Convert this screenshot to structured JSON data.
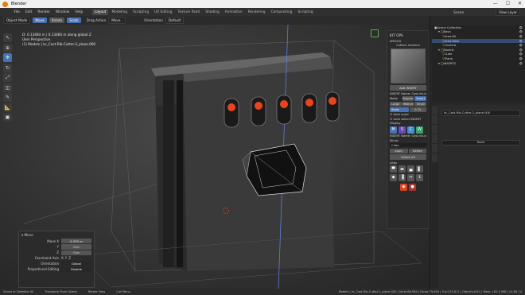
{
  "window": {
    "title": "Blender",
    "controls": [
      "—",
      "☐",
      "✕"
    ]
  },
  "menu": [
    "File",
    "Edit",
    "Render",
    "Window",
    "Help"
  ],
  "workspaces": {
    "tabs": [
      "Layout",
      "Modeling",
      "Sculpting",
      "UV Editing",
      "Texture Paint",
      "Shading",
      "Animation",
      "Rendering",
      "Compositing",
      "Scripting"
    ],
    "active": "Layout",
    "scene": "Scene",
    "view_layer": "View Layer"
  },
  "toolbar": {
    "mode": "Object Mode",
    "move": "Move",
    "rotate": "Rotate",
    "scale": "Scale",
    "drag_label": "Drag Action",
    "drag_value": "Move",
    "orientation": "Orientation",
    "orientation_value": "Default"
  },
  "viewport": {
    "info_line1": "D: 0.13484 m | 0.13484 m along global Z",
    "info_line2": "User Perspective",
    "info_line3": "(1) Models | kc_Cast-Rib-Cutter-2_plane.000"
  },
  "npanel": {
    "header": "KIT OPS",
    "kitops": "KPACKS",
    "thumb_label": "Cutters medium",
    "add_insert": "Add INSERT",
    "insert_name": "INSERT Name: Cast.rib-cu...",
    "mode_label": "Mode",
    "mode_opts": [
      "Regular",
      "Smart"
    ],
    "size_opts": [
      "Large",
      "Medium",
      "Small"
    ],
    "scale_label": "Scale",
    "scale_value": "0.75",
    "auto_scale": "Auto scale",
    "auto_select": "Auto select INSERT",
    "display": "Display",
    "icons": [
      "M",
      "S",
      "C",
      "W"
    ],
    "insert_name2": "INSERT Name: Cast.rib-cu...",
    "mirror": "Mirror",
    "object": "Cube",
    "apply": "Apply",
    "delete": "Delete",
    "select_all": "Select All",
    "align": "Align"
  },
  "ops": {
    "title": "Move",
    "rows": [
      {
        "label": "Move X",
        "value": "0.335 m"
      },
      {
        "label": "Y",
        "value": "0 m"
      },
      {
        "label": "Z",
        "value": "0 m"
      }
    ],
    "constraint": "Constraint Axis",
    "axes": [
      "X",
      "Y",
      "Z"
    ],
    "orientation_label": "Orientation",
    "orientation_value": "Global",
    "prop_label": "Proportional Editing",
    "prop_value": "Disable"
  },
  "outliner": {
    "rows": [
      {
        "name": "Scene Collection",
        "indent": 0,
        "sel": false
      },
      {
        "name": "Basic",
        "indent": 1,
        "sel": false
      },
      {
        "name": "Area.Fill",
        "indent": 2,
        "sel": false
      },
      {
        "name": "Area.Main",
        "indent": 2,
        "sel": true
      },
      {
        "name": "Camera",
        "indent": 2,
        "sel": false
      },
      {
        "name": "Models",
        "indent": 1,
        "sel": false
      },
      {
        "name": "Cube",
        "indent": 2,
        "sel": false
      },
      {
        "name": "Plane",
        "indent": 2,
        "sel": false
      },
      {
        "name": "INSERTS",
        "indent": 1,
        "sel": false
      }
    ]
  },
  "properties": {
    "object_name": "kc_Cast-Rib-Cutter-2_plane.000",
    "field_none": "None"
  },
  "status": {
    "left": "Select or Deselect All",
    "mid1": "Transform From Gizmo",
    "mid2": "Rotate View",
    "mid3": "Call Menu",
    "right": "Models | kc_Cast-Rib-Cutter-2_plane.000 | Verts:68,964 | Faces:79,694 | Tris:153,611 | Objects:0/51 | Mem: 183.3 MiB | v2.80.74"
  }
}
